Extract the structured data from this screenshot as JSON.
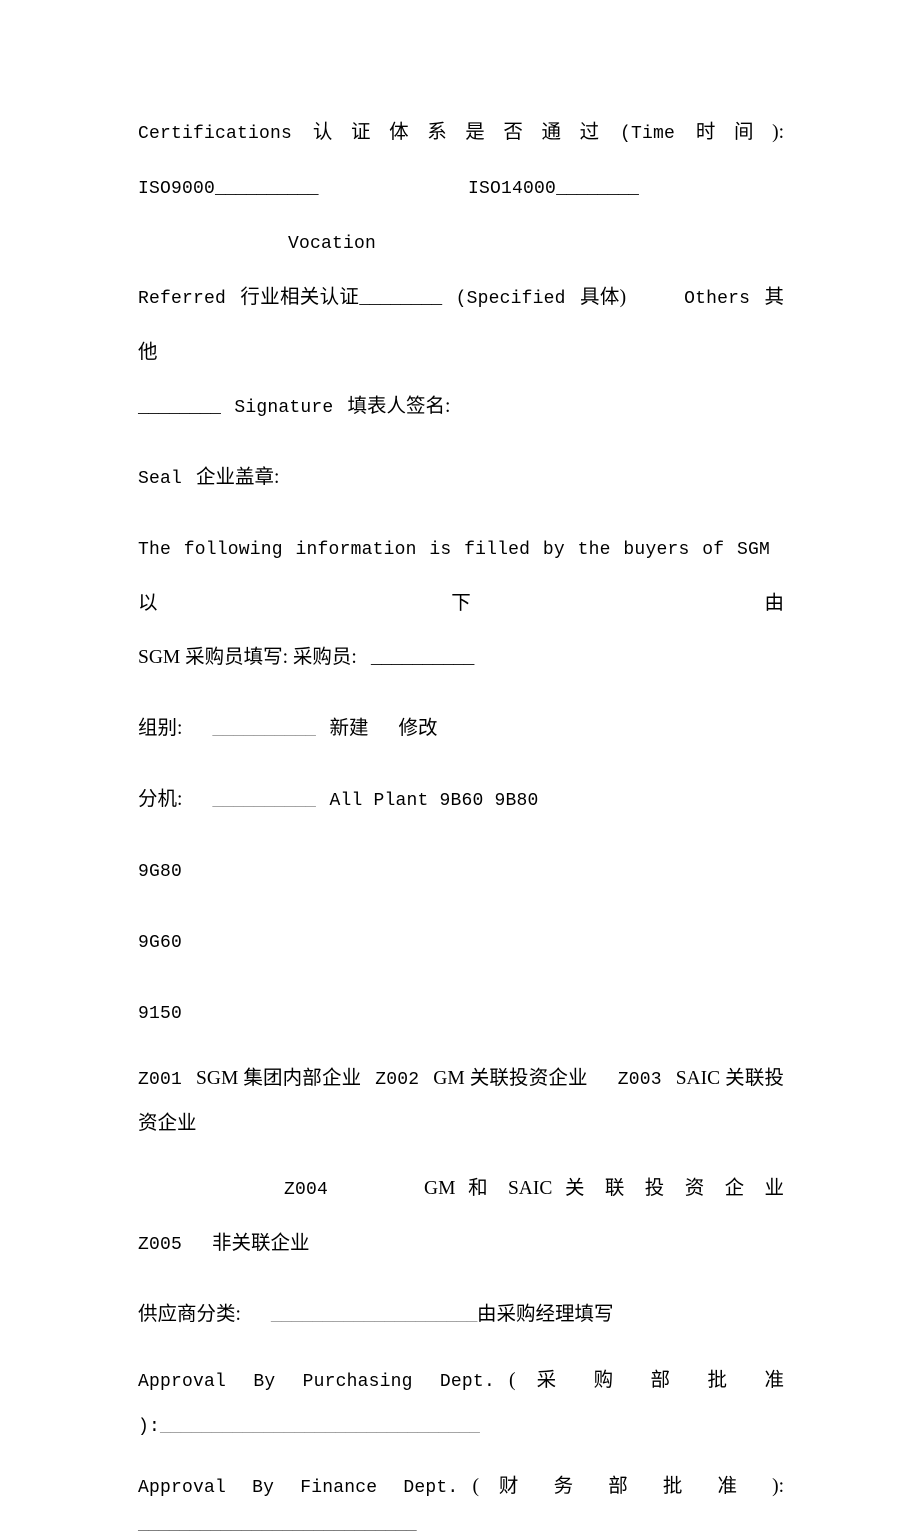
{
  "document": {
    "type": "form",
    "language": "bilingual-en-zh",
    "page_background": "#ffffff",
    "text_color": "#000000",
    "blank_rule_color": "#9a9a9a"
  },
  "certifications": {
    "line1_en": "Certifications",
    "line1_zh": "认 证 体 系 是 否 通 过",
    "line1_time_en": "(Time",
    "line1_time_zh": "时 间 ):",
    "iso9000_label": "ISO9000",
    "iso9000_blank": "__________",
    "iso14000_label": "ISO14000",
    "iso14000_blank": "________",
    "vocation_word": "Vocation",
    "referred_word": "Referred",
    "referred_zh": "行业相关认证",
    "referred_blank": "________",
    "specified_en": "(Specified",
    "specified_zh": "具体)",
    "others_en": "Others",
    "others_zh": "其他",
    "signature_blank": "________",
    "signature_en": "Signature",
    "signature_zh": "填表人签名:"
  },
  "seal": {
    "label_en": "Seal",
    "label_zh": "企业盖章:"
  },
  "buyers_section": {
    "intro_en": "The following information is filled by the buyers of SGM",
    "intro_zh_part1": "以下由",
    "intro_zh_part2": "SGM 采购员填写: 采购员:",
    "intro_blank": "__________"
  },
  "group": {
    "label_zh": "组别:",
    "blank": "__________",
    "option_new": "新建",
    "option_modify": "修改"
  },
  "extension": {
    "label_zh": "分机:",
    "blank": "__________",
    "options": "All Plant 9B60 9B80"
  },
  "plant_codes": [
    "9G80",
    "9G60",
    "9150"
  ],
  "vendor_classes": {
    "z001_code": "Z001",
    "z001_label": "SGM 集团内部企业",
    "z002_code": "Z002",
    "z002_label": "GM 关联投资企业",
    "z003_code": "Z003",
    "z003_label_line1": "SAIC 关联投",
    "z003_label_line2": "资企业",
    "z004_code": "Z004",
    "z004_label": "GM 和 SAIC 关 联 投 资 企 业",
    "z005_code": "Z005",
    "z005_label": "非关联企业"
  },
  "supplier_category": {
    "label_zh": "供应商分类:",
    "blank": "____________________",
    "note_zh": "由采购经理填写"
  },
  "approvals": {
    "purchasing_en": "Approval   By   Purchasing   Dept.",
    "purchasing_zh": "( 采 购 部 批 准",
    "purchasing_close": "):",
    "purchasing_blank": "_______________________________",
    "finance_en": "Approval   By   Finance   Dept.",
    "finance_zh": "( 财 务 部 批 准 ):",
    "finance_blank": "___________________________"
  }
}
